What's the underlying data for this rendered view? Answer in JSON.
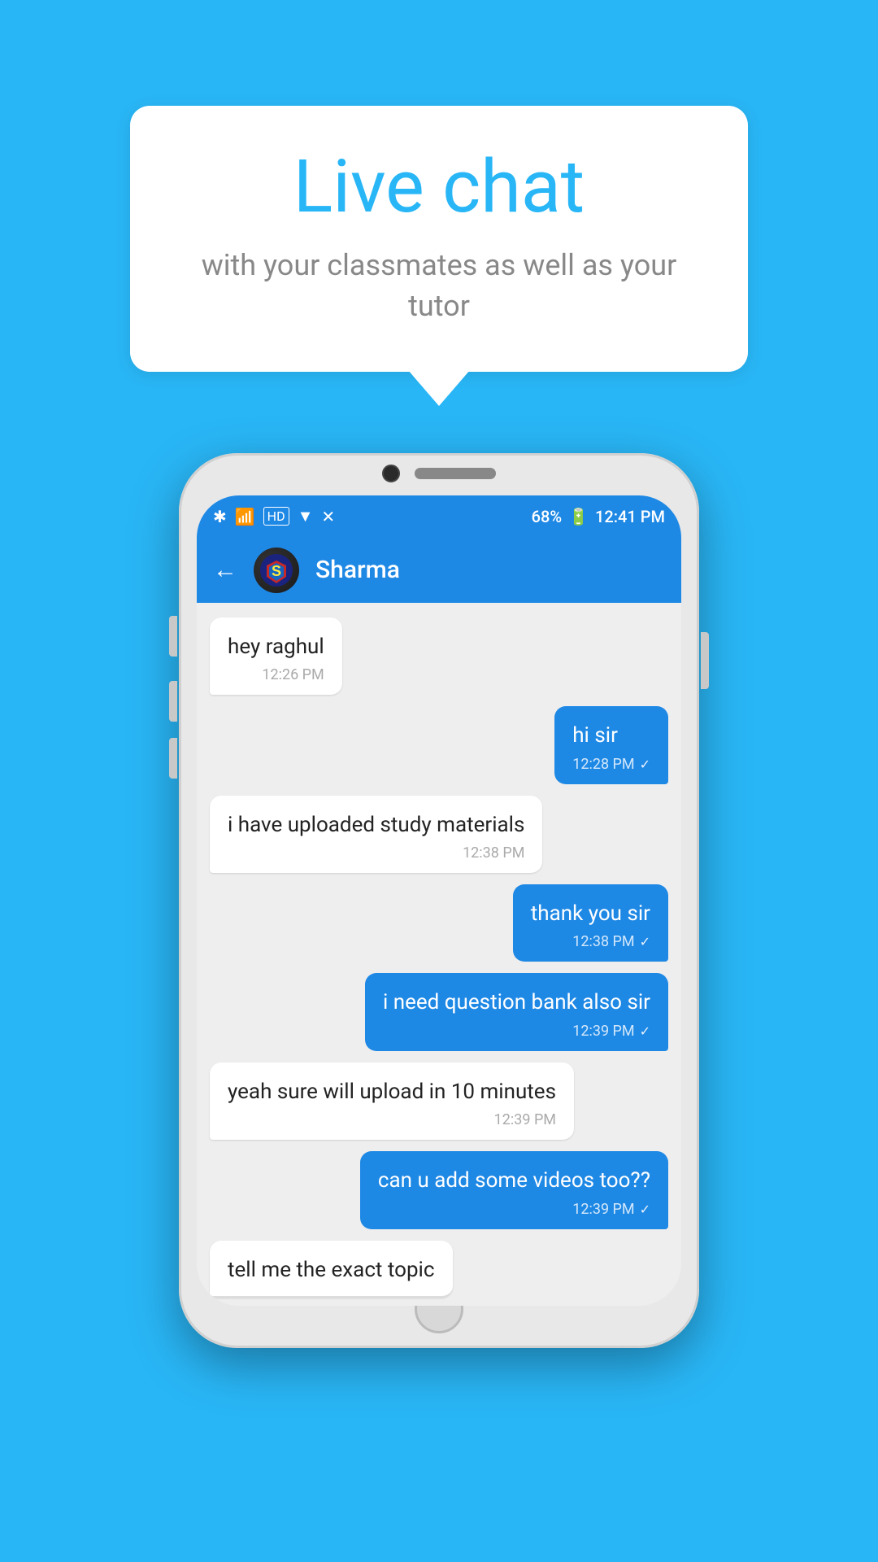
{
  "background_color": "#29b6f6",
  "bubble": {
    "title": "Live chat",
    "subtitle": "with your classmates as well as your tutor"
  },
  "phone": {
    "status_bar": {
      "time": "12:41 PM",
      "battery": "68%",
      "icons": "bluetooth, signal, wifi, hd"
    },
    "chat_header": {
      "back_label": "←",
      "contact_name": "Sharma",
      "avatar_emoji": "🛡"
    },
    "messages": [
      {
        "id": 1,
        "type": "received",
        "text": "hey raghul",
        "time": "12:26 PM",
        "check": false
      },
      {
        "id": 2,
        "type": "sent",
        "text": "hi sir",
        "time": "12:28 PM",
        "check": true
      },
      {
        "id": 3,
        "type": "received",
        "text": "i have uploaded study materials",
        "time": "12:38 PM",
        "check": false
      },
      {
        "id": 4,
        "type": "sent",
        "text": "thank you sir",
        "time": "12:38 PM",
        "check": true
      },
      {
        "id": 5,
        "type": "sent",
        "text": "i need question bank also sir",
        "time": "12:39 PM",
        "check": true
      },
      {
        "id": 6,
        "type": "received",
        "text": "yeah sure will upload in 10 minutes",
        "time": "12:39 PM",
        "check": false
      },
      {
        "id": 7,
        "type": "sent",
        "text": "can u add some videos too??",
        "time": "12:39 PM",
        "check": true
      },
      {
        "id": 8,
        "type": "received_partial",
        "text": "tell me the exact topic",
        "time": "",
        "check": false
      }
    ]
  }
}
